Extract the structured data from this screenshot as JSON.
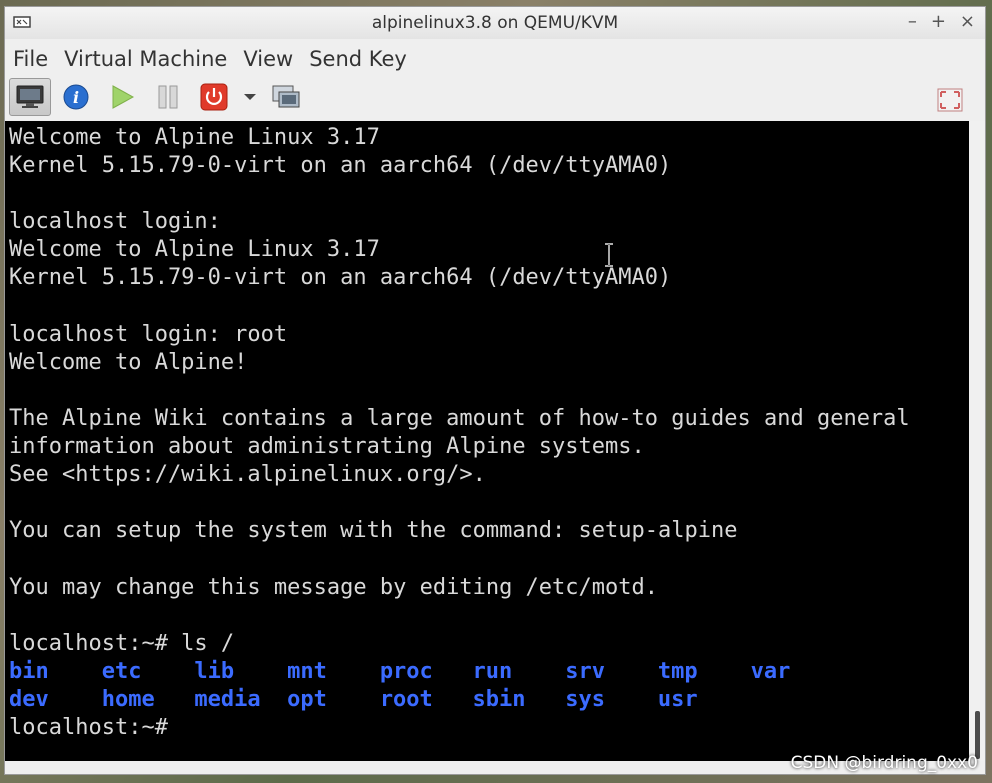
{
  "window": {
    "title": "alpinelinux3.8 on QEMU/KVM",
    "controls": [
      "–",
      "+",
      "×"
    ]
  },
  "menu": [
    "File",
    "Virtual Machine",
    "View",
    "Send Key"
  ],
  "toolbar": {
    "buttons": [
      "console-icon",
      "info-icon",
      "run-icon",
      "pause-icon",
      "power-icon",
      "power-menu-chevron-icon",
      "snapshot-icon",
      "fullscreen-icon"
    ]
  },
  "terminal": {
    "lines": [
      "Welcome to Alpine Linux 3.17",
      "Kernel 5.15.79-0-virt on an aarch64 (/dev/ttyAMA0)",
      "",
      "localhost login:",
      "Welcome to Alpine Linux 3.17",
      "Kernel 5.15.79-0-virt on an aarch64 (/dev/ttyAMA0)",
      "",
      "localhost login: root",
      "Welcome to Alpine!",
      "",
      "The Alpine Wiki contains a large amount of how-to guides and general",
      "information about administrating Alpine systems.",
      "See <https://wiki.alpinelinux.org/>.",
      "",
      "You can setup the system with the command: setup-alpine",
      "",
      "You may change this message by editing /etc/motd.",
      "",
      "localhost:~# ls /"
    ],
    "ls_row1": [
      "bin",
      "etc",
      "lib",
      "mnt",
      "proc",
      "run",
      "srv",
      "tmp",
      "var"
    ],
    "ls_row2": [
      "dev",
      "home",
      "media",
      "opt",
      "root",
      "sbin",
      "sys",
      "usr"
    ],
    "prompt": "localhost:~# "
  },
  "colors": {
    "terminal_bg": "#000000",
    "terminal_fg": "#d9d9d9",
    "dir_color": "#3b6bff"
  },
  "watermark": "CSDN @birdring_0xx0"
}
